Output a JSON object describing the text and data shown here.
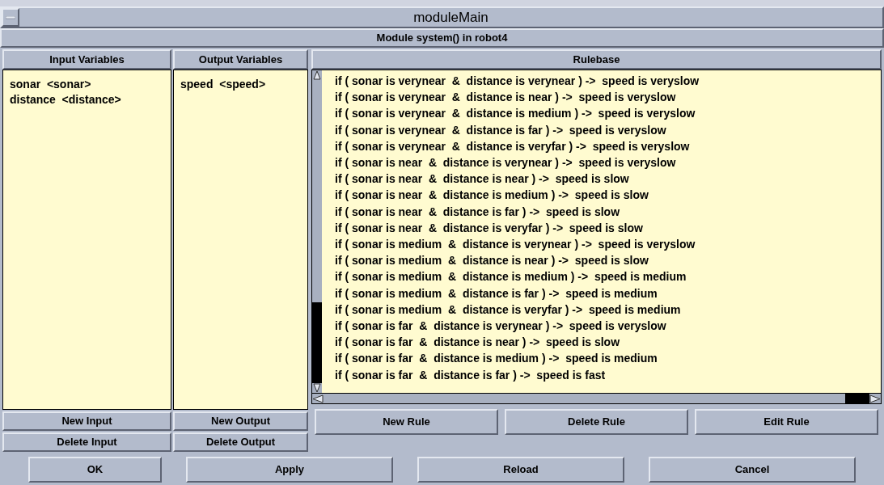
{
  "window": {
    "title": "moduleMain"
  },
  "subtitle": "Module system() in robot4",
  "inputs": {
    "heading": "Input Variables",
    "items": [
      "sonar  <sonar>",
      "distance  <distance>"
    ],
    "buttons": [
      "New Input",
      "Delete Input"
    ]
  },
  "outputs": {
    "heading": "Output Variables",
    "items": [
      "speed  <speed>"
    ],
    "buttons": [
      "New Output",
      "Delete Output"
    ]
  },
  "rulebase": {
    "heading": "Rulebase",
    "rules": [
      "if ( sonar is verynear  &  distance is verynear ) ->  speed is veryslow",
      "if ( sonar is verynear  &  distance is near ) ->  speed is veryslow",
      "if ( sonar is verynear  &  distance is medium ) ->  speed is veryslow",
      "if ( sonar is verynear  &  distance is far ) ->  speed is veryslow",
      "if ( sonar is verynear  &  distance is veryfar ) ->  speed is veryslow",
      "if ( sonar is near  &  distance is verynear ) ->  speed is veryslow",
      "if ( sonar is near  &  distance is near ) ->  speed is slow",
      "if ( sonar is near  &  distance is medium ) ->  speed is slow",
      "if ( sonar is near  &  distance is far ) ->  speed is slow",
      "if ( sonar is near  &  distance is veryfar ) ->  speed is slow",
      "if ( sonar is medium  &  distance is verynear ) ->  speed is veryslow",
      "if ( sonar is medium  &  distance is near ) ->  speed is slow",
      "if ( sonar is medium  &  distance is medium ) ->  speed is medium",
      "if ( sonar is medium  &  distance is far ) ->  speed is medium",
      "if ( sonar is medium  &  distance is veryfar ) ->  speed is medium",
      "if ( sonar is far  &  distance is verynear ) ->  speed is veryslow",
      "if ( sonar is far  &  distance is near ) ->  speed is slow",
      "if ( sonar is far  &  distance is medium ) ->  speed is medium",
      "if ( sonar is far  &  distance is far ) ->  speed is fast"
    ],
    "buttons": [
      "New Rule",
      "Delete Rule",
      "Edit Rule"
    ]
  },
  "dialog_buttons": [
    "OK",
    "Apply",
    "Reload",
    "Cancel"
  ]
}
